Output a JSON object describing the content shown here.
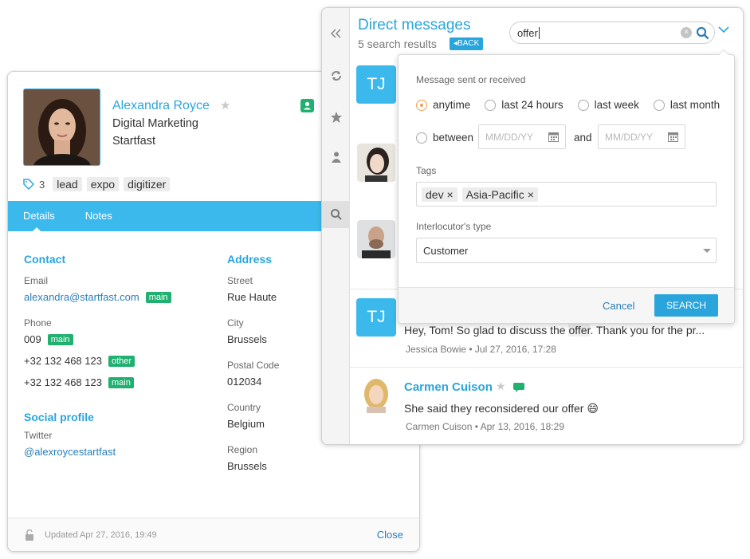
{
  "contact": {
    "name": "Alexandra Royce",
    "job_title": "Digital Marketing",
    "company": "Startfast",
    "tag_count": "3",
    "tags": [
      "lead",
      "expo",
      "digitizer"
    ],
    "tabs": [
      "Details",
      "Notes"
    ],
    "contact_section": {
      "title": "Contact",
      "email_label": "Email",
      "email": "alexandra@startfast.com",
      "email_badge": "main",
      "phone_label": "Phone",
      "phones": [
        {
          "number": "009",
          "badge": "main"
        },
        {
          "number": "+32 132 468 123",
          "badge": "other"
        },
        {
          "number": "+32 132 468 123",
          "badge": "main"
        }
      ]
    },
    "social_section": {
      "title": "Social profile",
      "twitter_label": "Twitter",
      "twitter": "@alexroycestartfast"
    },
    "address_section": {
      "title": "Address",
      "street_label": "Street",
      "street": "Rue Haute",
      "city_label": "City",
      "city": "Brussels",
      "postal_label": "Postal Code",
      "postal": "012034",
      "country_label": "Country",
      "country": "Belgium",
      "region_label": "Region",
      "region": "Brussels"
    },
    "footer": {
      "updated": "Updated  Apr 27, 2016, 19:49",
      "close_label": "Close"
    }
  },
  "messages": {
    "title": "Direct messages",
    "results": "5 search results",
    "back_label": "BACK",
    "search_value": "offer",
    "clear_symbol": "×",
    "items": [
      {
        "avatar_initials": "TJ",
        "text_before": "Hey, Tom! So glad to discuss the ",
        "text_highlight": "offer",
        "text_after": ". Thank you for the pr...",
        "meta": "Jessica Bowie • Jul 27, 2016, 17:28"
      },
      {
        "name": "Carmen Cuison",
        "text": "She said they reconsidered our offer 😄",
        "meta": "Carmen Cuison • Apr 13, 2016, 18:29"
      }
    ],
    "top_avatar_initials": "TJ"
  },
  "filter": {
    "sent_label": "Message sent or received",
    "options": [
      "anytime",
      "last 24 hours",
      "last week",
      "last month"
    ],
    "selected": "anytime",
    "between_label": "between",
    "and_label": "and",
    "date_placeholder": "MM/DD/YY",
    "tags_label": "Tags",
    "tags": [
      "dev",
      "Asia-Pacific"
    ],
    "remove_symbol": "×",
    "type_label": "Interlocutor's type",
    "type_value": "Customer",
    "cancel_label": "Cancel",
    "search_label": "SEARCH"
  },
  "colors": {
    "accent": "#2aa5dc",
    "tabbar": "#3cb9ec",
    "badge_green": "#20b070"
  }
}
